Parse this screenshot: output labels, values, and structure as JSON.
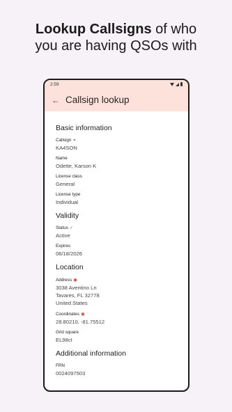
{
  "headline": {
    "bold": "Lookup Callsigns",
    "rest_line1": " of who",
    "line2": "you are having QSOs with"
  },
  "statusbar": {
    "time": "2:59"
  },
  "appbar": {
    "title": "Callsign lookup"
  },
  "sections": {
    "basic": {
      "title": "Basic information",
      "callsign_label": "Callsign",
      "callsign_value": "KA4SON",
      "name_label": "Name",
      "name_value": "Odette, Karson K",
      "license_class_label": "License class",
      "license_class_value": "General",
      "license_type_label": "License type",
      "license_type_value": "Individual"
    },
    "validity": {
      "title": "Validity",
      "status_label": "Status",
      "status_value": "Active",
      "expires_label": "Expires",
      "expires_value": "06/18/2026"
    },
    "location": {
      "title": "Location",
      "address_label": "Address",
      "address_line1": "3038 Aventino Ln",
      "address_line2": "Tavares, FL 32778",
      "address_line3": "United States",
      "coords_label": "Coordinates",
      "coords_value": "28.80210, -81.75512",
      "grid_label": "Grid square",
      "grid_value": "EL98ct"
    },
    "additional": {
      "title": "Additional information",
      "frn_label": "FRN",
      "frn_value": "0024097503"
    }
  },
  "colors": {
    "appbar_bg": "#fde2dc",
    "page_bg": "#f7f2f7"
  }
}
